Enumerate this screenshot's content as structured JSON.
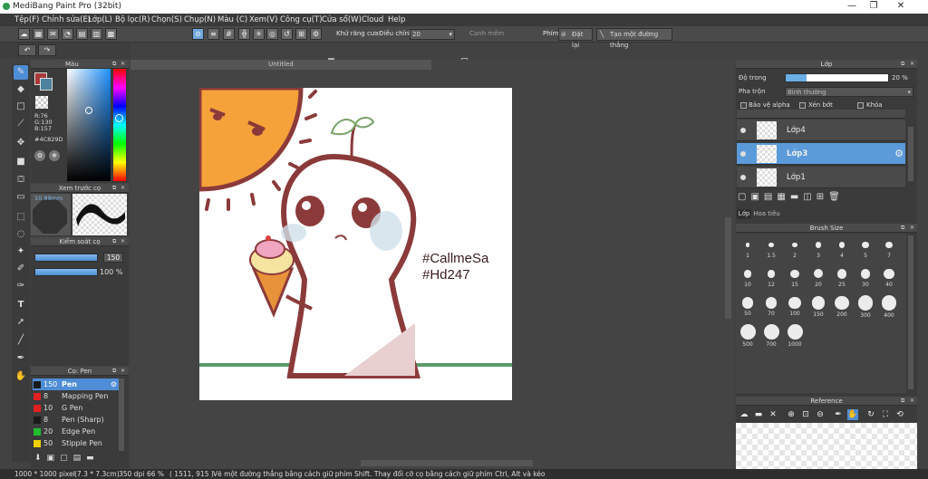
{
  "window": {
    "title": "MediBang Paint Pro (32bit)",
    "minimize": "—",
    "maximize": "❐",
    "close": "✕"
  },
  "menu": [
    "Tệp(F)",
    "Chỉnh sửa(E)",
    "Lớp(L)",
    "Bộ lọc(R)",
    "Chọn(S)",
    "Chụp(N)",
    "Màu (C)",
    "Xem(V)",
    "Công cụ(T)",
    "Cửa sổ(W)",
    "Cloud",
    "Help"
  ],
  "toolbar": {
    "antialias_label": "Khử răng cưa",
    "adjust_label": "Điều chỉnh",
    "adjust_value": "20",
    "edge_label": "Cạnh mềm",
    "phim_label": "Phím",
    "reset_label": "Đặt lại",
    "create_line_label": "Tạo một đường thẳng"
  },
  "color_panel": {
    "title": "Màu",
    "r": "R:76",
    "g": "G:130",
    "b": "B:157",
    "hex": "#4C829D",
    "primary_color": "#a83a3a",
    "secondary_color": "#4C829D"
  },
  "brush_preview": {
    "title": "Xem trước cọ",
    "size_label": "10.89mm"
  },
  "brush_control": {
    "title": "Kiểm soát cọ",
    "size_value": "150",
    "opacity_value": "100 %"
  },
  "brush_list": {
    "title": "Cọ: Pen",
    "items": [
      {
        "size": "150",
        "name": "Pen",
        "color": "#1a1a1a"
      },
      {
        "size": "8",
        "name": "Mapping Pen",
        "color": "#e02020"
      },
      {
        "size": "10",
        "name": "G Pen",
        "color": "#e02020"
      },
      {
        "size": "8",
        "name": "Pen (Sharp)",
        "color": "#1a1a1a"
      },
      {
        "size": "20",
        "name": "Edge Pen",
        "color": "#1fbf2f"
      },
      {
        "size": "50",
        "name": "Stipple Pen",
        "color": "#f0d000"
      }
    ]
  },
  "document": {
    "tab_title": "Untitled",
    "hashtag1": "#CallmeSa",
    "hashtag2": "#Hd247"
  },
  "layer_panel": {
    "title": "Lớp",
    "opacity_label": "Độ trong",
    "opacity_value": "20 %",
    "opacity_fraction": 0.2,
    "blend_label": "Pha trộn",
    "blend_value": "Bình thường",
    "protect_alpha": "Bảo vệ alpha",
    "clipping": "Xén bớt",
    "lock": "Khóa",
    "layers": [
      "Lớp4",
      "Lớp3",
      "Lớp1"
    ],
    "selected_layer": "Lớp3",
    "tabs": [
      "Lớp",
      "Hoa tiêu"
    ]
  },
  "brush_size_panel": {
    "title": "Brush Size",
    "sizes": [
      "1",
      "1.5",
      "2",
      "3",
      "4",
      "5",
      "7",
      "10",
      "12",
      "15",
      "20",
      "25",
      "30",
      "40",
      "50",
      "70",
      "100",
      "150",
      "200",
      "300",
      "400",
      "500",
      "700",
      "1000"
    ]
  },
  "reference_panel": {
    "title": "Reference"
  },
  "status": {
    "size": "1000 * 1000 pixel",
    "cm": "(7.3 * 7.3cm)",
    "dpi": "350 dpi",
    "zoom": "66 %",
    "coords": "( 1511, 915 )",
    "hint": "Vẽ một đường thẳng bằng cách giữ phím Shift. Thay đổi cỡ cọ bằng cách giữ phím Ctrl, Alt và kéo"
  }
}
